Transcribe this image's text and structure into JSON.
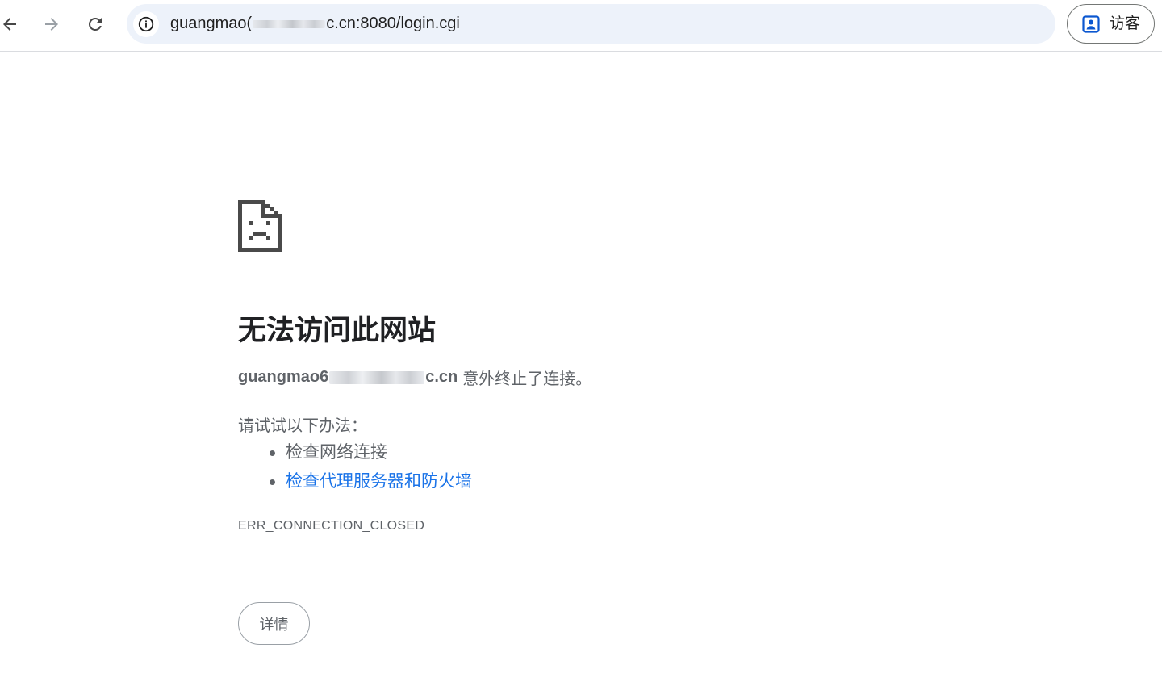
{
  "browser": {
    "url": {
      "prefix": "guangmao(",
      "suffix": "c.cn:8080/login.cgi"
    },
    "profile_label": "访客",
    "icons": {
      "back": "arrow-left-icon",
      "forward": "arrow-right-icon",
      "reload": "reload-icon",
      "site_info": "info-icon",
      "profile": "person-badge-icon"
    }
  },
  "error_page": {
    "icon": "sad-page-icon",
    "title": "无法访问此网站",
    "host_prefix": "guangmao6",
    "host_suffix": "c.cn",
    "host_message": "意外终止了连接。",
    "suggestions_heading": "请试试以下办法：",
    "suggestions": [
      "检查网络连接",
      "检查代理服务器和防火墙"
    ],
    "error_code": "ERR_CONNECTION_CLOSED",
    "details_button": "详情"
  },
  "colors": {
    "omnibox_bg": "#edf2fa",
    "link": "#1a73e8",
    "text_secondary": "#5f6368",
    "title": "#202124",
    "profile_icon": "#0b57d0"
  }
}
